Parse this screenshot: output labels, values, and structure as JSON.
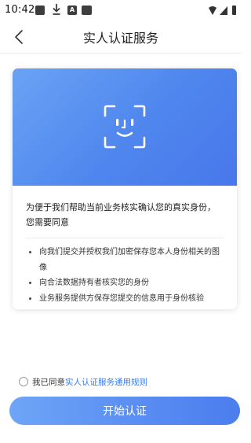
{
  "status_bar": {
    "time": "10:42",
    "icons": [
      "notification-icon",
      "download-icon",
      "app-icon",
      "app-icon-2",
      "wifi-icon",
      "signal-icon"
    ],
    "app_icon_letter": "A"
  },
  "header": {
    "title": "实人认证服务",
    "back_icon": "chevron-left-icon"
  },
  "card": {
    "face_icon": "face-scan-icon",
    "intro": "为便于我们帮助当前业务核实确认您的真实身份，您需要同意",
    "bullets": [
      "向我们提交并授权我们加密保存您本人身份相关的图像",
      "向合法数据持有者核实您的身份",
      "业务服务提供方保存您提交的信息用于身份核验"
    ]
  },
  "agreement": {
    "prefix": "我已同意",
    "link": "实人认证服务通用规则",
    "checked": false
  },
  "start_button": {
    "label": "开始认证"
  },
  "colors": {
    "accent": "#3a7bf0",
    "gradient_start": "#6aa3f5",
    "gradient_end": "#4877ea"
  }
}
